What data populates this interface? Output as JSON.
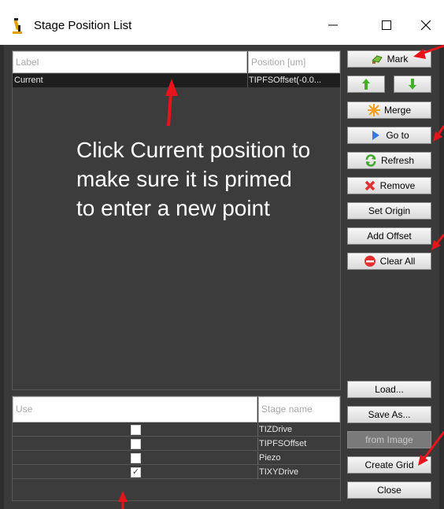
{
  "window": {
    "title": "Stage Position List",
    "minimize_glyph": "—",
    "maximize_glyph": "☐",
    "close_glyph": "✕"
  },
  "position_table": {
    "columns": [
      "Label",
      "Position [um]"
    ],
    "rows": [
      {
        "label": "Current",
        "position": "TIPFSOffset(-0.0..."
      }
    ]
  },
  "annotation": {
    "text": "Click Current position to make sure  it is primed to enter a new point"
  },
  "stage_table": {
    "columns": [
      "Use",
      "Stage name"
    ],
    "rows": [
      {
        "use": false,
        "name": "TIZDrive"
      },
      {
        "use": false,
        "name": "TIPFSOffset"
      },
      {
        "use": false,
        "name": "Piezo"
      },
      {
        "use": true,
        "name": "TIXYDrive"
      }
    ]
  },
  "buttons": {
    "mark": "Mark",
    "up_icon": "up-arrow-icon",
    "down_icon": "down-arrow-icon",
    "merge": "Merge",
    "goto": "Go to",
    "refresh": "Refresh",
    "remove": "Remove",
    "set_origin": "Set Origin",
    "add_offset": "Add Offset",
    "clear_all": "Clear All",
    "load": "Load...",
    "save_as": "Save As...",
    "from_image": "from Image",
    "create_grid": "Create Grid",
    "close": "Close"
  },
  "colors": {
    "panel_bg": "#3a3a3a",
    "selected_row_bg": "#1e1e1e",
    "annotation_arrow": "#e8141b",
    "annotation_text": "#ffffff"
  }
}
